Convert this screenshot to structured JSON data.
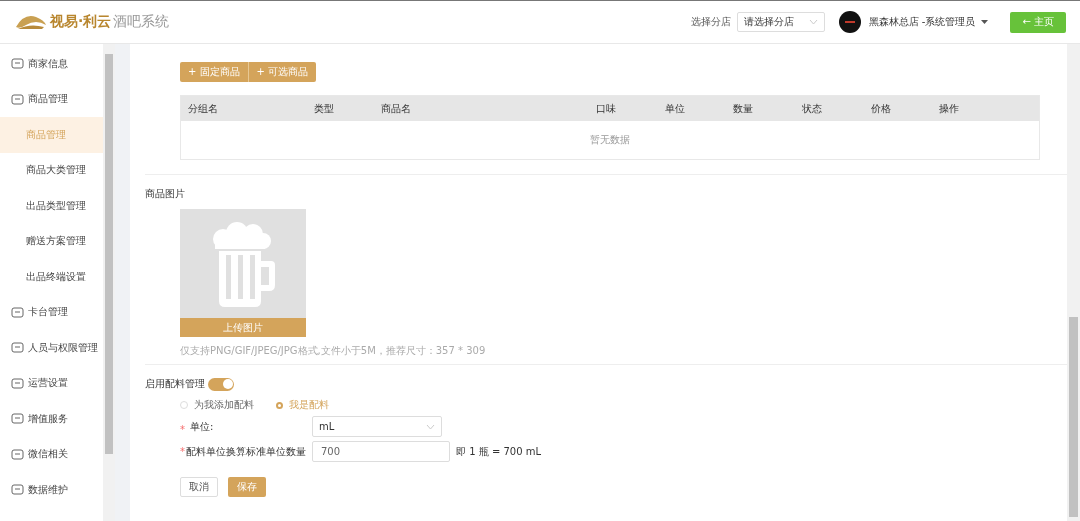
{
  "header": {
    "logo_brand": "视易·利云",
    "logo_product": "酒吧系统",
    "branch_label": "选择分店",
    "branch_select": {
      "placeholder": "请选择分店"
    },
    "user": "黑森林总店 -系统管理员",
    "home_button": "← 主页"
  },
  "sidebar": {
    "items": [
      {
        "label": "商家信息",
        "selected": false
      },
      {
        "label": "商品管理",
        "selected": false,
        "expanded": true,
        "children": [
          {
            "label": "商品管理",
            "selected": true
          },
          {
            "label": "商品大类管理",
            "selected": false
          },
          {
            "label": "出品类型管理",
            "selected": false
          },
          {
            "label": "赠送方案管理",
            "selected": false
          },
          {
            "label": "出品终端设置",
            "selected": false
          }
        ]
      },
      {
        "label": "卡台管理",
        "selected": false
      },
      {
        "label": "人员与权限管理",
        "selected": false
      },
      {
        "label": "运营设置",
        "selected": false
      },
      {
        "label": "增值服务",
        "selected": false
      },
      {
        "label": "微信相关",
        "selected": false
      },
      {
        "label": "数据维护",
        "selected": false
      }
    ]
  },
  "product_buttons": [
    "+ 固定商品",
    "+ 可选商品"
  ],
  "table": {
    "columns": [
      "分组名",
      "类型",
      "商品名",
      "口味",
      "单位",
      "数量",
      "状态",
      "价格",
      "操作"
    ],
    "empty_text": "暂无数据"
  },
  "image_section": {
    "title": "商品图片",
    "upload_button": "上传图片",
    "hint": "仅支持PNG/GIF/JPEG/JPG格式,文件小于5M，推荐尺寸：357 * 309"
  },
  "ingredient": {
    "label": "启用配料管理",
    "enabled": true,
    "options": [
      {
        "label": "为我添加配料",
        "selected": false
      },
      {
        "label": "我是配料",
        "selected": true
      }
    ],
    "unit": {
      "required_mark": "*",
      "label": "单位:",
      "value": "mL"
    },
    "quantity": {
      "required_mark": "*",
      "label": "配料单位换算标准单位数量",
      "value": "700",
      "note": "即 1 瓶 = 700 mL"
    }
  },
  "actions": {
    "cancel": "取消",
    "save": "保存"
  }
}
